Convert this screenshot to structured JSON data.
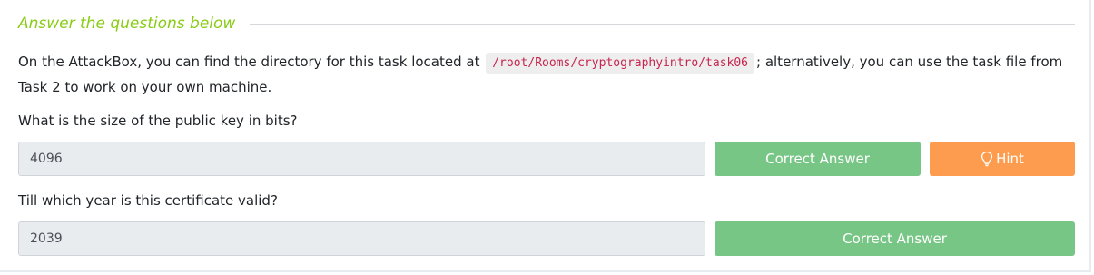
{
  "header": {
    "title": "Answer the questions below"
  },
  "intro": {
    "text_before": "On the AttackBox, you can find the directory for this task located at",
    "code_path": "/root/Rooms/cryptographyintro/task06",
    "text_after": "; alternatively, you can use the task file from Task 2 to work on your own machine."
  },
  "questions": [
    {
      "question": "What is the size of the public key in bits?",
      "answer": "4096",
      "status_label": "Correct Answer",
      "hint_label": "Hint"
    },
    {
      "question": "Till which year is this certificate valid?",
      "answer": "2039",
      "status_label": "Correct Answer"
    }
  ],
  "colors": {
    "accent_green": "#88cc14",
    "correct": "#77c685",
    "hint": "#fd9c4e",
    "code_text": "#c7254e"
  },
  "icons": {
    "hint_icon": "lightbulb-icon"
  }
}
